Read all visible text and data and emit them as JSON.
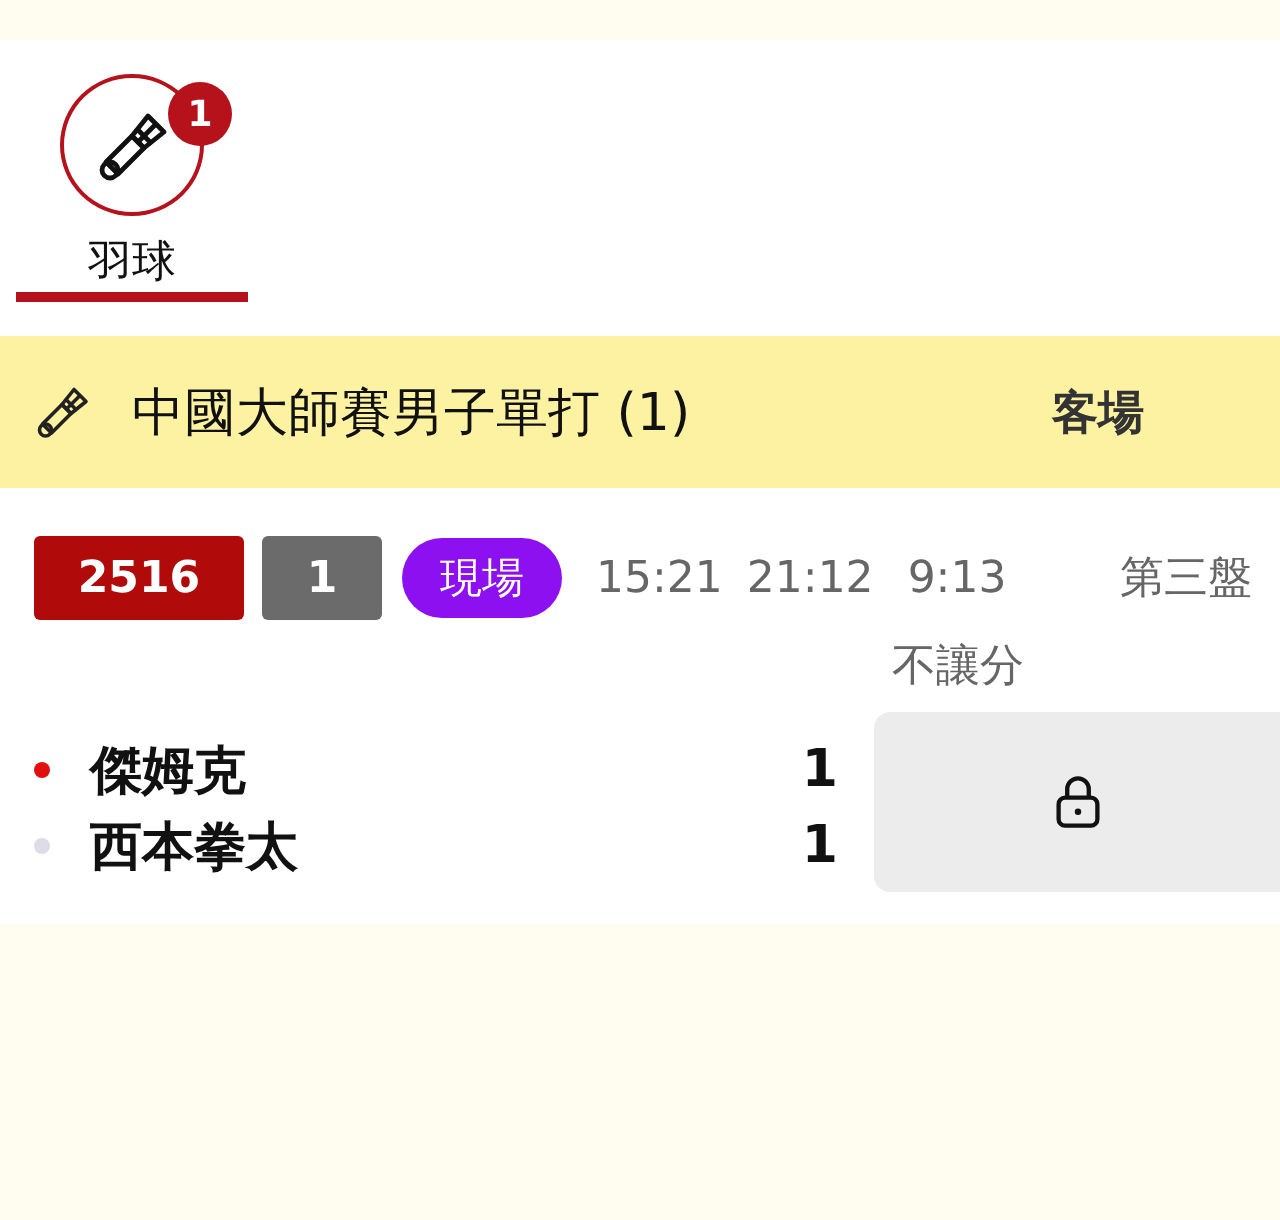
{
  "sport_tabs": [
    {
      "label": "羽球",
      "badge": "1",
      "selected": true
    }
  ],
  "event": {
    "title": "中國大師賽男子單打 (1)",
    "column_label": "客場"
  },
  "match": {
    "code": "2516",
    "number": "1",
    "status": "現場",
    "times": [
      "15:21",
      "21:12",
      "9:13"
    ],
    "period": "第三盤",
    "market_label": "不讓分",
    "players": [
      {
        "name": "傑姆克",
        "score": "1",
        "serving": true
      },
      {
        "name": "西本拳太",
        "score": "1",
        "serving": false
      }
    ],
    "locked": true
  }
}
